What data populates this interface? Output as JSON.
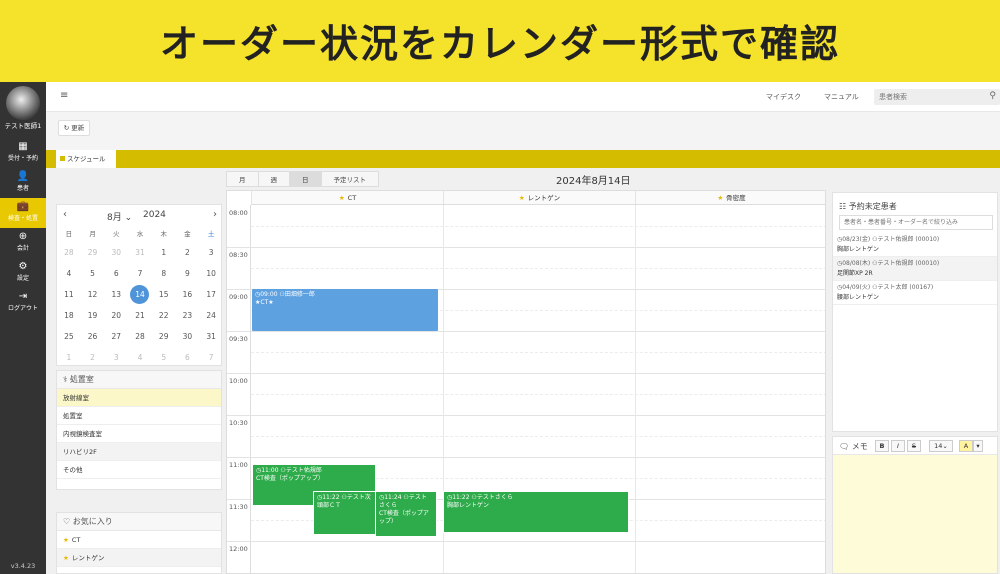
{
  "banner": {
    "title": "オーダー状況をカレンダー形式で確認"
  },
  "sidebar": {
    "user": "テスト医師1",
    "version": "v3.4.23",
    "items": [
      {
        "icon": "calendar-icon",
        "glyph": "▦",
        "label": "受付・予約"
      },
      {
        "icon": "patient-icon",
        "glyph": "👤",
        "label": "患者"
      },
      {
        "icon": "exam-icon",
        "glyph": "💼",
        "label": "検査・処置"
      },
      {
        "icon": "accounting-icon",
        "glyph": "⊕",
        "label": "会計"
      },
      {
        "icon": "settings-icon",
        "glyph": "⚙",
        "label": "設定"
      },
      {
        "icon": "logout-icon",
        "glyph": "⇥",
        "label": "ログアウト"
      }
    ]
  },
  "header": {
    "menu_glyph": "≡",
    "my_desk": "マイデスク",
    "manual": "マニュアル",
    "search_placeholder": "患者検索",
    "search_glyph": "⚲"
  },
  "toolbar": {
    "refresh_label": "更新"
  },
  "tabs": {
    "active": "スケジュール"
  },
  "mini_calendar": {
    "month": "8月",
    "year": "2024",
    "weekdays": [
      "日",
      "月",
      "火",
      "水",
      "木",
      "金",
      "土"
    ],
    "weeks": [
      [
        "28",
        "29",
        "30",
        "31",
        "1",
        "2",
        "3"
      ],
      [
        "4",
        "5",
        "6",
        "7",
        "8",
        "9",
        "10"
      ],
      [
        "11",
        "12",
        "13",
        "14",
        "15",
        "16",
        "17"
      ],
      [
        "18",
        "19",
        "20",
        "21",
        "22",
        "23",
        "24"
      ],
      [
        "25",
        "26",
        "27",
        "28",
        "29",
        "30",
        "31"
      ],
      [
        "1",
        "2",
        "3",
        "4",
        "5",
        "6",
        "7"
      ]
    ],
    "selected": "14"
  },
  "rooms_panel": {
    "title": "処置室",
    "items": [
      "放射線室",
      "処置室",
      "内視鏡検査室",
      "リハビリ2F",
      "その他"
    ]
  },
  "favorites_panel": {
    "title": "お気に入り",
    "items": [
      "CT",
      "レントゲン"
    ]
  },
  "schedule": {
    "views": [
      "月",
      "週",
      "日",
      "予定リスト"
    ],
    "date": "2024年8月14日",
    "columns": [
      "CT",
      "レントゲン",
      "骨密度"
    ],
    "times": [
      "08:00",
      "08:30",
      "09:00",
      "09:30",
      "10:00",
      "10:30",
      "11:00",
      "11:30",
      "12:00"
    ],
    "events": [
      {
        "color": "blue",
        "line1": "◷09:00 ⚇田畑修一郎",
        "line2": "★CT★"
      },
      {
        "color": "green",
        "line1": "◷11:00 ⚇テスト佑規郎",
        "line2": "CT検査（ポップアップ）"
      },
      {
        "color": "green",
        "line1": "◷11:22 ⚇テスト次",
        "line2": "頭部ＣＴ"
      },
      {
        "color": "green",
        "line1": "◷11:24 ⚇テスト",
        "line2": "さくら",
        "line3": "CT検査（ポップアップ）"
      },
      {
        "color": "green",
        "line1": "◷11:22 ⚇テストさくら",
        "line2": "胸部レントゲン"
      }
    ]
  },
  "unscheduled": {
    "title": "予約未定患者",
    "search_placeholder": "患者名・患者番号・オーダー名で絞り込み",
    "items": [
      {
        "date": "◷08/23(金)",
        "patient": "⚇テスト佑規郎 (00010)",
        "exam": "胸部レントゲン"
      },
      {
        "date": "◷08/08(木)",
        "patient": "⚇テスト佑規郎 (00010)",
        "exam": "足関節XP 2R"
      },
      {
        "date": "◷04/09(火)",
        "patient": "⚇テスト太郎 (00167)",
        "exam": "腰部レントゲン"
      }
    ]
  },
  "memo": {
    "title": "メモ",
    "bold": "B",
    "italic": "I",
    "strike": "S",
    "font_size": "14",
    "color_btn": "A"
  }
}
